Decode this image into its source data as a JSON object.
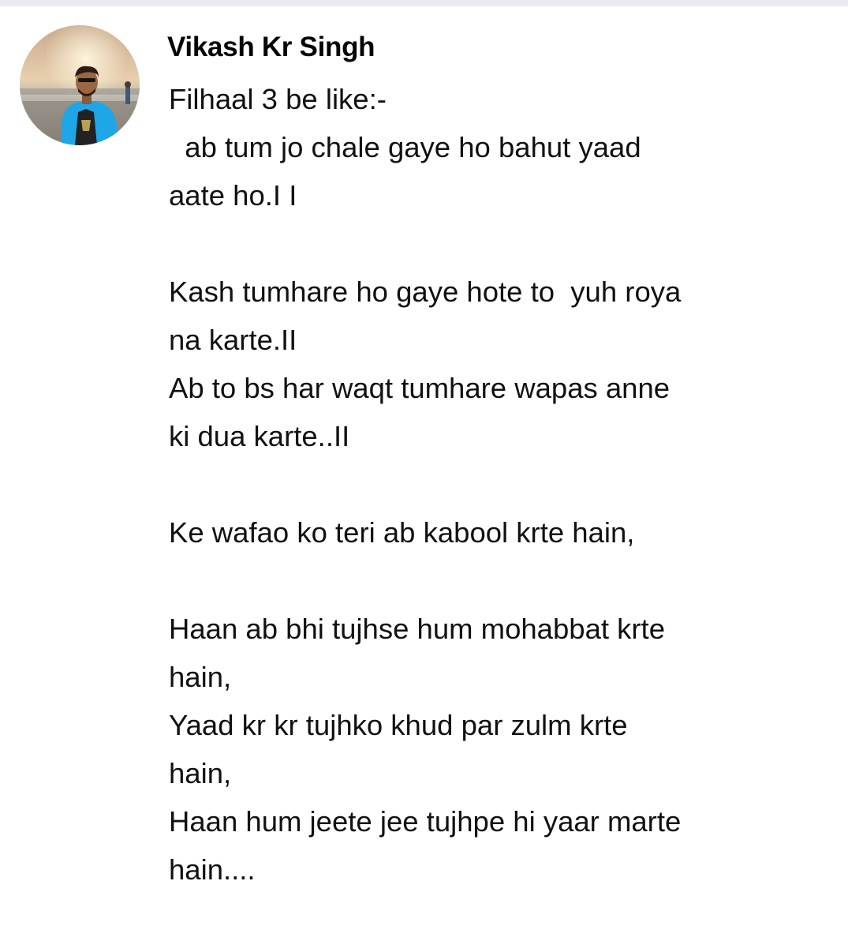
{
  "comment": {
    "author": "Vikash Kr Singh",
    "avatar_icon": "profile-photo",
    "lines": [
      "Filhaal 3 be like:-",
      "  ab tum jo chale gaye ho bahut yaad",
      "aate ho.I I",
      "",
      "Kash tumhare ho gaye hote to  yuh roya",
      "na karte.II",
      "Ab to bs har waqt tumhare wapas anne",
      "ki dua karte..II",
      "",
      "Ke wafao ko teri ab kabool krte hain,",
      "",
      "Haan ab bhi tujhse hum mohabbat krte",
      "hain,",
      "Yaad kr kr tujhko khud par zulm krte",
      "hain,",
      "Haan hum jeete jee tujhpe hi yaar marte",
      "hain...."
    ]
  },
  "colors": {
    "text": "#111111",
    "author": "#050505",
    "top_band": "#e9eaed",
    "background": "#ffffff"
  }
}
